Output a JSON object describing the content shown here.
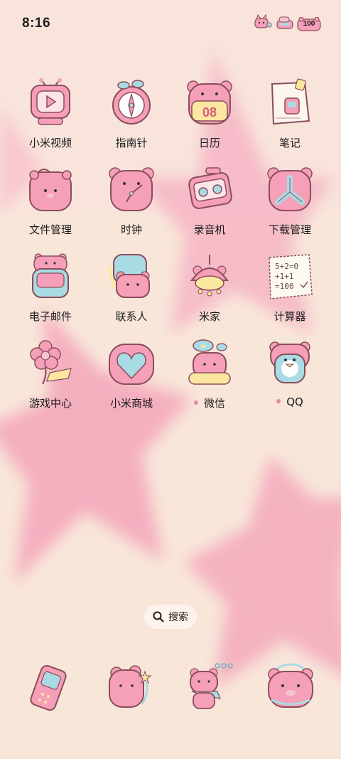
{
  "status_bar": {
    "time": "8:16",
    "battery_level": "100",
    "icons": [
      "cat-sticker-icon",
      "bear-sticker-icon",
      "battery-icon"
    ]
  },
  "apps": [
    {
      "label": "小米视频",
      "icon": "tv-video-icon"
    },
    {
      "label": "指南针",
      "icon": "compass-icon"
    },
    {
      "label": "日历",
      "icon": "calendar-bear-icon"
    },
    {
      "label": "笔记",
      "icon": "notes-icon"
    },
    {
      "label": "文件管理",
      "icon": "folder-bear-icon"
    },
    {
      "label": "时钟",
      "icon": "clock-bear-icon"
    },
    {
      "label": "录音机",
      "icon": "recorder-icon"
    },
    {
      "label": "下载管理",
      "icon": "download-bear-icon"
    },
    {
      "label": "电子邮件",
      "icon": "mail-bear-icon"
    },
    {
      "label": "联系人",
      "icon": "contacts-bear-icon"
    },
    {
      "label": "米家",
      "icon": "mijia-icon"
    },
    {
      "label": "计算器",
      "icon": "calculator-icon"
    },
    {
      "label": "游戏中心",
      "icon": "game-flower-icon"
    },
    {
      "label": "小米商城",
      "icon": "heart-shop-icon"
    },
    {
      "label": "微信",
      "icon": "wechat-bear-icon",
      "new_dot": true
    },
    {
      "label": "QQ",
      "icon": "qq-penguin-icon",
      "new_dot": true
    }
  ],
  "search": {
    "label": "搜索"
  },
  "dock": [
    {
      "icon": "phone-icon"
    },
    {
      "icon": "messages-bear-icon"
    },
    {
      "icon": "browser-bear-icon"
    },
    {
      "icon": "camera-bear-icon"
    }
  ],
  "colors": {
    "wallpaper": "#f8e4d8",
    "star_pink": "#f4a9bd",
    "icon_pink": "#f39ab5",
    "icon_blue": "#a9dbe4",
    "dot": "#e8889a"
  }
}
